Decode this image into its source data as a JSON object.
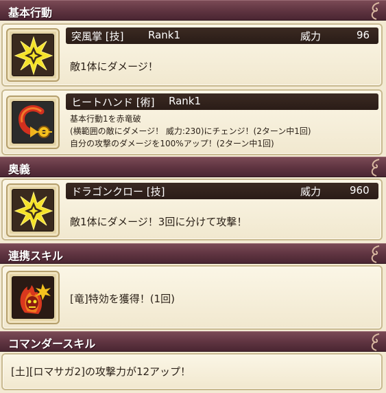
{
  "sections": {
    "basic": {
      "title": "基本行動"
    },
    "ougi": {
      "title": "奥義"
    },
    "renkei": {
      "title": "連携スキル"
    },
    "commander": {
      "title": "コマンダースキル"
    }
  },
  "skill1": {
    "name": "突風掌 [技]",
    "rank": "Rank1",
    "power_label": "威力",
    "power_value": "96",
    "desc": "敵1体にダメージ！",
    "icon": "starburst-icon"
  },
  "skill2": {
    "name": "ヒートハンド [術]",
    "rank": "Rank1",
    "desc_lines": [
      "基本行動1を赤竜破",
      "(横範囲の敵にダメージ！ 威力:230)にチェンジ！(2ターン中1回)",
      "自分の攻撃のダメージを100%アップ！(2ターン中1回)"
    ],
    "icon": "heat-hand-icon"
  },
  "ougi_skill": {
    "name": "ドラゴンクロー [技]",
    "power_label": "威力",
    "power_value": "960",
    "desc": "敵1体にダメージ！3回に分けて攻撃！",
    "icon": "starburst-icon"
  },
  "renkei_skill": {
    "desc": "[竜]特効を獲得！(1回)",
    "icon": "flaming-skull-icon"
  },
  "commander_skill": {
    "desc": "[土][ロマサガ2]の攻撃力が12アップ！"
  },
  "colors": {
    "header_bg": "#5e3340",
    "panel_bg": "#f3ead3",
    "title_bar_bg": "#2f201a",
    "icon_yellow": "#f5e32a"
  }
}
